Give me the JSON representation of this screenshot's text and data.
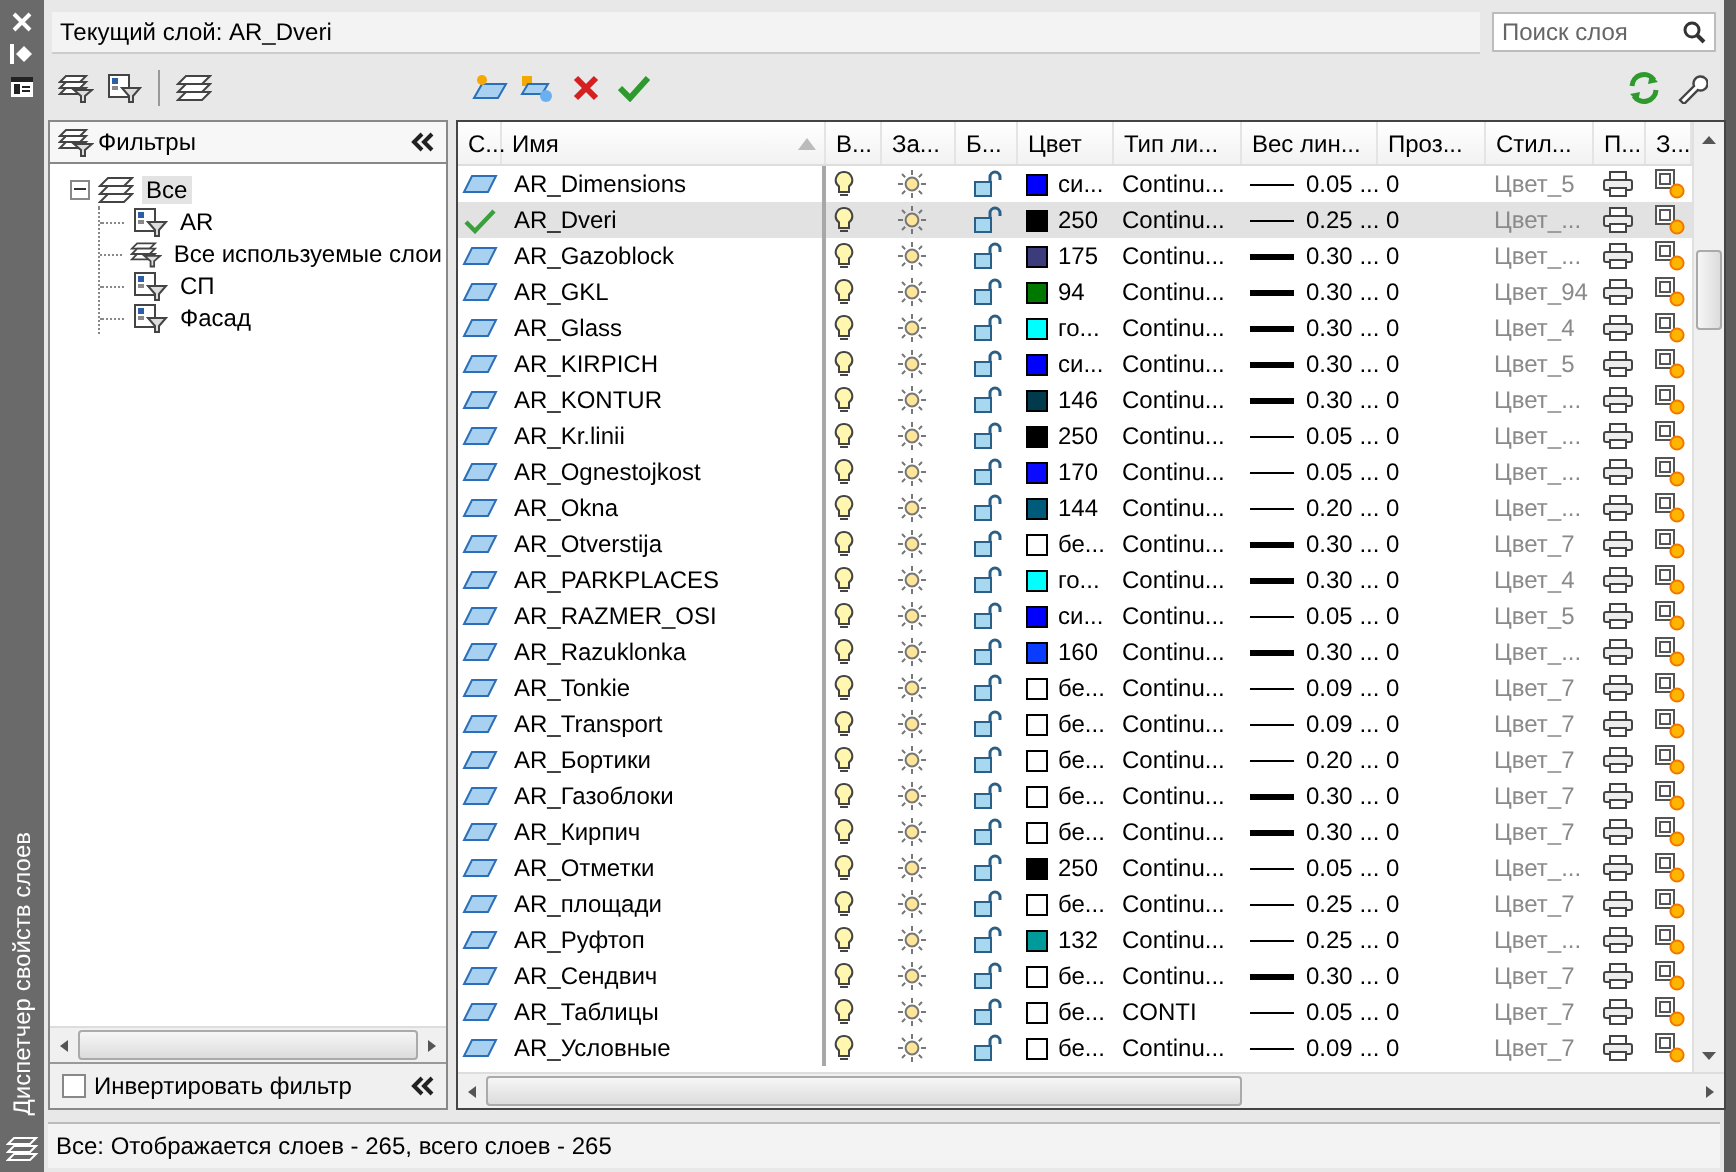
{
  "panel_title": "Диспетчер свойств слоев",
  "current_layer": "Текущий слой: AR_Dveri",
  "search": {
    "placeholder": "Поиск слоя"
  },
  "filters": {
    "title": "Фильтры",
    "tree": [
      {
        "label": "Все",
        "kind": "all",
        "expanded": true,
        "selected": true,
        "children": [
          {
            "label": "AR",
            "kind": "group",
            "selected": false
          },
          {
            "label": "Все используемые слои",
            "kind": "property",
            "selected": false
          },
          {
            "label": "СП",
            "kind": "group",
            "selected": false
          },
          {
            "label": "Фасад",
            "kind": "group",
            "selected": false
          }
        ]
      }
    ],
    "invert": {
      "label": "Инвертировать фильтр",
      "checked": false
    }
  },
  "columns": [
    "С...",
    "Имя",
    "В...",
    "За...",
    "Б...",
    "Цвет",
    "Тип ли...",
    "Вес лин...",
    "Проз...",
    "Стил...",
    "П...",
    "З..."
  ],
  "layers": [
    {
      "name": "AR_Dimensions",
      "current": false,
      "selected": false,
      "color": "#0000ff",
      "color_name": "си...",
      "linetype": "Continu...",
      "heavy": false,
      "lineweight": "0.05 ...",
      "transparency": "0",
      "plot_style": "Цвет_5"
    },
    {
      "name": "AR_Dveri",
      "current": true,
      "selected": true,
      "color": "#000000",
      "color_name": "250",
      "linetype": "Continu...",
      "heavy": false,
      "lineweight": "0.25 ...",
      "transparency": "0",
      "plot_style": "Цвет_..."
    },
    {
      "name": "AR_Gazoblock",
      "current": false,
      "selected": false,
      "color": "#3c3c7c",
      "color_name": "175",
      "linetype": "Continu...",
      "heavy": true,
      "lineweight": "0.30 ...",
      "transparency": "0",
      "plot_style": "Цвет_..."
    },
    {
      "name": "AR_GKL",
      "current": false,
      "selected": false,
      "color": "#007800",
      "color_name": "94",
      "linetype": "Continu...",
      "heavy": true,
      "lineweight": "0.30 ...",
      "transparency": "0",
      "plot_style": "Цвет_94"
    },
    {
      "name": "AR_Glass",
      "current": false,
      "selected": false,
      "color": "#00ffff",
      "color_name": "го...",
      "linetype": "Continu...",
      "heavy": true,
      "lineweight": "0.30 ...",
      "transparency": "0",
      "plot_style": "Цвет_4"
    },
    {
      "name": "AR_KIRPICH",
      "current": false,
      "selected": false,
      "color": "#0000ff",
      "color_name": "си...",
      "linetype": "Continu...",
      "heavy": true,
      "lineweight": "0.30 ...",
      "transparency": "0",
      "plot_style": "Цвет_5"
    },
    {
      "name": "AR_KONTUR",
      "current": false,
      "selected": false,
      "color": "#003a4c",
      "color_name": "146",
      "linetype": "Continu...",
      "heavy": true,
      "lineweight": "0.30 ...",
      "transparency": "0",
      "plot_style": "Цвет_..."
    },
    {
      "name": "AR_Kr.linii",
      "current": false,
      "selected": false,
      "color": "#000000",
      "color_name": "250",
      "linetype": "Continu...",
      "heavy": false,
      "lineweight": "0.05 ...",
      "transparency": "0",
      "plot_style": "Цвет_..."
    },
    {
      "name": "AR_Ognestojkost",
      "current": false,
      "selected": false,
      "color": "#0a0aff",
      "color_name": "170",
      "linetype": "Continu...",
      "heavy": false,
      "lineweight": "0.05 ...",
      "transparency": "0",
      "plot_style": "Цвет_..."
    },
    {
      "name": "AR_Okna",
      "current": false,
      "selected": false,
      "color": "#005a7a",
      "color_name": "144",
      "linetype": "Continu...",
      "heavy": false,
      "lineweight": "0.20 ...",
      "transparency": "0",
      "plot_style": "Цвет_..."
    },
    {
      "name": "AR_Otverstija",
      "current": false,
      "selected": false,
      "color": "#ffffff",
      "color_name": "бе...",
      "linetype": "Continu...",
      "heavy": true,
      "lineweight": "0.30 ...",
      "transparency": "0",
      "plot_style": "Цвет_7"
    },
    {
      "name": "AR_PARKPLACES",
      "current": false,
      "selected": false,
      "color": "#00ffff",
      "color_name": "го...",
      "linetype": "Continu...",
      "heavy": true,
      "lineweight": "0.30 ...",
      "transparency": "0",
      "plot_style": "Цвет_4"
    },
    {
      "name": "AR_RAZMER_OSI",
      "current": false,
      "selected": false,
      "color": "#0000ff",
      "color_name": "си...",
      "linetype": "Continu...",
      "heavy": false,
      "lineweight": "0.05 ...",
      "transparency": "0",
      "plot_style": "Цвет_5"
    },
    {
      "name": "AR_Razuklonka",
      "current": false,
      "selected": false,
      "color": "#0a3cff",
      "color_name": "160",
      "linetype": "Continu...",
      "heavy": true,
      "lineweight": "0.30 ...",
      "transparency": "0",
      "plot_style": "Цвет_..."
    },
    {
      "name": "AR_Tonkie",
      "current": false,
      "selected": false,
      "color": "#ffffff",
      "color_name": "бе...",
      "linetype": "Continu...",
      "heavy": false,
      "lineweight": "0.09 ...",
      "transparency": "0",
      "plot_style": "Цвет_7"
    },
    {
      "name": "AR_Transport",
      "current": false,
      "selected": false,
      "color": "#ffffff",
      "color_name": "бе...",
      "linetype": "Continu...",
      "heavy": false,
      "lineweight": "0.09 ...",
      "transparency": "0",
      "plot_style": "Цвет_7"
    },
    {
      "name": "AR_Бортики",
      "current": false,
      "selected": false,
      "color": "#ffffff",
      "color_name": "бе...",
      "linetype": "Continu...",
      "heavy": false,
      "lineweight": "0.20 ...",
      "transparency": "0",
      "plot_style": "Цвет_7"
    },
    {
      "name": "AR_Газоблоки",
      "current": false,
      "selected": false,
      "color": "#ffffff",
      "color_name": "бе...",
      "linetype": "Continu...",
      "heavy": true,
      "lineweight": "0.30 ...",
      "transparency": "0",
      "plot_style": "Цвет_7"
    },
    {
      "name": "AR_Кирпич",
      "current": false,
      "selected": false,
      "color": "#ffffff",
      "color_name": "бе...",
      "linetype": "Continu...",
      "heavy": true,
      "lineweight": "0.30 ...",
      "transparency": "0",
      "plot_style": "Цвет_7"
    },
    {
      "name": "AR_Отметки",
      "current": false,
      "selected": false,
      "color": "#000000",
      "color_name": "250",
      "linetype": "Continu...",
      "heavy": false,
      "lineweight": "0.05 ...",
      "transparency": "0",
      "plot_style": "Цвет_..."
    },
    {
      "name": "AR_площади",
      "current": false,
      "selected": false,
      "color": "#ffffff",
      "color_name": "бе...",
      "linetype": "Continu...",
      "heavy": false,
      "lineweight": "0.25 ...",
      "transparency": "0",
      "plot_style": "Цвет_7"
    },
    {
      "name": "AR_Руфтоп",
      "current": false,
      "selected": false,
      "color": "#009a9a",
      "color_name": "132",
      "linetype": "Continu...",
      "heavy": false,
      "lineweight": "0.25 ...",
      "transparency": "0",
      "plot_style": "Цвет_..."
    },
    {
      "name": "AR_Сендвич",
      "current": false,
      "selected": false,
      "color": "#ffffff",
      "color_name": "бе...",
      "linetype": "Continu...",
      "heavy": true,
      "lineweight": "0.30 ...",
      "transparency": "0",
      "plot_style": "Цвет_7"
    },
    {
      "name": "AR_Таблицы",
      "current": false,
      "selected": false,
      "color": "#ffffff",
      "color_name": "бе...",
      "linetype": "CONTI",
      "heavy": false,
      "lineweight": "0.05 ...",
      "transparency": "0",
      "plot_style": "Цвет_7"
    },
    {
      "name": "AR_Условные",
      "current": false,
      "selected": false,
      "color": "#ffffff",
      "color_name": "бе...",
      "linetype": "Continu...",
      "heavy": false,
      "lineweight": "0.09 ...",
      "transparency": "0",
      "plot_style": "Цвет_7"
    }
  ],
  "status_bar": "Все: Отображается слоев - 265, всего слоев - 265"
}
